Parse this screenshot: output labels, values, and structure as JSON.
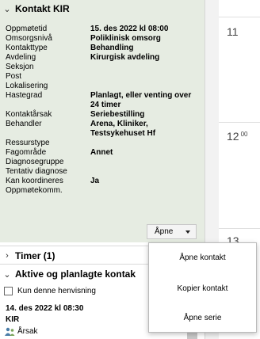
{
  "kir_section": {
    "title": "Kontakt KIR",
    "rows": [
      {
        "label": "Oppmøtetid",
        "value": "15. des 2022 kl 08:00"
      },
      {
        "label": "Omsorgsnivå",
        "value": "Poliklinisk omsorg"
      },
      {
        "label": "Kontakttype",
        "value": "Behandling"
      },
      {
        "label": "Avdeling",
        "value": "Kirurgisk avdeling"
      },
      {
        "label": "Seksjon",
        "value": ""
      },
      {
        "label": "Post",
        "value": ""
      },
      {
        "label": "Lokalisering",
        "value": ""
      },
      {
        "label": "Hastegrad",
        "value": "Planlagt, eller venting over"
      },
      {
        "label": "",
        "value": "24 timer"
      },
      {
        "label": "Kontaktårsak",
        "value": "Seriebestilling"
      },
      {
        "label": "Behandler",
        "value": "Arena, Kliniker,"
      },
      {
        "label": "",
        "value": "Testsykehuset Hf"
      },
      {
        "label": "Ressurstype",
        "value": ""
      },
      {
        "label": "Fagområde",
        "value": "Annet"
      },
      {
        "label": "Diagnosegruppe",
        "value": ""
      },
      {
        "label": "Tentativ diagnose",
        "value": ""
      },
      {
        "label": "Kan koordineres",
        "value": "Ja"
      },
      {
        "label": "Oppmøtekomm.",
        "value": ""
      }
    ],
    "open_button_label": "Åpne"
  },
  "timer_section": {
    "title": "Timer (1)"
  },
  "aktive_section": {
    "title": "Aktive og planlagte kontak",
    "checkbox_label": "Kun denne henvisning",
    "entry_date": "14. des 2022 kl 08:30",
    "entry_type": "KIR",
    "entry_reason": "Årsak"
  },
  "dropdown_menu": {
    "items": [
      "Åpne kontakt",
      "Kopier kontakt",
      "Åpne serie"
    ]
  },
  "calendar": {
    "hours": [
      "11",
      "12"
    ],
    "minutes_label": "00",
    "partial_hour": "13"
  },
  "colors": {
    "kir_background": "#e6ece2",
    "panel_background": "#ffffff"
  }
}
